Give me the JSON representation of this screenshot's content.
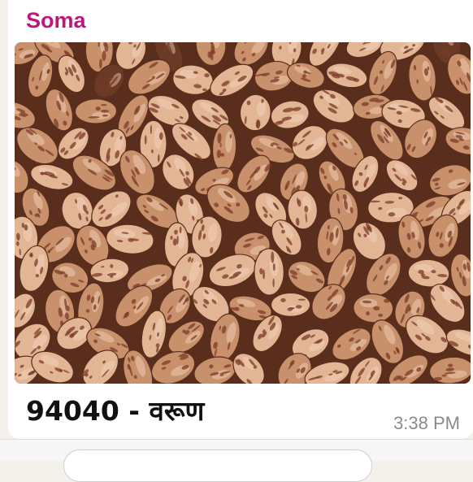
{
  "message": {
    "sender": "Soma",
    "sender_color": "#c0157a",
    "caption": "94040 - वरूण",
    "time": "3:38 PM"
  },
  "photo": {
    "subject": "pinto beans",
    "colors": {
      "base": "#c9906c",
      "light": "#e2b595",
      "speckle": "#7a3b24",
      "shadow": "#5a2e1c"
    }
  },
  "composer": {
    "placeholder": ""
  }
}
